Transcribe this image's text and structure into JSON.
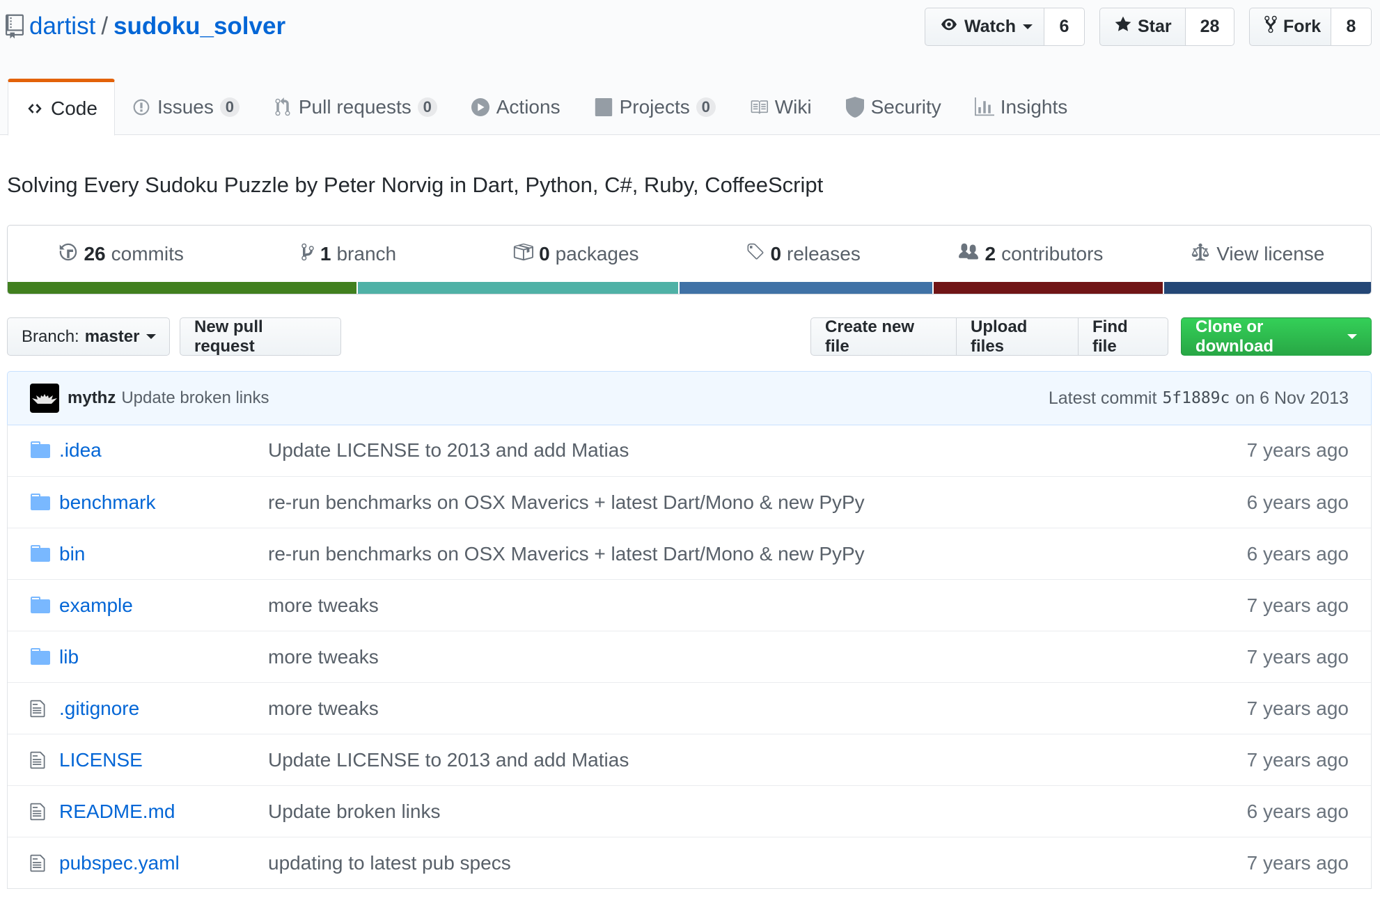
{
  "repo": {
    "owner": "dartist",
    "separator": "/",
    "name": "sudoku_solver",
    "description": "Solving Every Sudoku Puzzle by Peter Norvig in Dart, Python, C#, Ruby, CoffeeScript"
  },
  "actions": {
    "watch_label": "Watch",
    "watch_count": "6",
    "star_label": "Star",
    "star_count": "28",
    "fork_label": "Fork",
    "fork_count": "8"
  },
  "tabs": [
    {
      "label": "Code",
      "icon": "code-icon"
    },
    {
      "label": "Issues",
      "counter": "0",
      "icon": "issue-icon"
    },
    {
      "label": "Pull requests",
      "counter": "0",
      "icon": "pull-request-icon"
    },
    {
      "label": "Actions",
      "icon": "play-icon"
    },
    {
      "label": "Projects",
      "counter": "0",
      "icon": "project-icon"
    },
    {
      "label": "Wiki",
      "icon": "book-icon"
    },
    {
      "label": "Security",
      "icon": "shield-icon"
    },
    {
      "label": "Insights",
      "icon": "graph-icon"
    }
  ],
  "summary": [
    {
      "count": "26",
      "label": "commits",
      "icon": "history-icon"
    },
    {
      "count": "1",
      "label": "branch",
      "icon": "git-branch-icon"
    },
    {
      "count": "0",
      "label": "packages",
      "icon": "package-icon"
    },
    {
      "count": "0",
      "label": "releases",
      "icon": "tag-icon"
    },
    {
      "count": "2",
      "label": "contributors",
      "icon": "people-icon"
    },
    {
      "count": "",
      "label": "View license",
      "icon": "law-icon"
    }
  ],
  "language_colors": [
    "#41801f",
    "#4fb1a6",
    "#4072a6",
    "#701516",
    "#244776"
  ],
  "file_nav": {
    "branch_prefix": "Branch:",
    "branch_name": "master",
    "new_pr": "New pull request",
    "create_file": "Create new file",
    "upload_files": "Upload files",
    "find_file": "Find file",
    "clone": "Clone or download"
  },
  "latest_commit": {
    "author": "mythz",
    "message": "Update broken links",
    "prefix": "Latest commit",
    "sha": "5f1889c",
    "date": "on 6 Nov 2013"
  },
  "files": [
    {
      "type": "dir",
      "name": ".idea",
      "message": "Update LICENSE to 2013 and add Matias",
      "age": "7 years ago"
    },
    {
      "type": "dir",
      "name": "benchmark",
      "message": "re-run benchmarks on OSX Maverics + latest Dart/Mono & new PyPy",
      "age": "6 years ago"
    },
    {
      "type": "dir",
      "name": "bin",
      "message": "re-run benchmarks on OSX Maverics + latest Dart/Mono & new PyPy",
      "age": "6 years ago"
    },
    {
      "type": "dir",
      "name": "example",
      "message": "more tweaks",
      "age": "7 years ago"
    },
    {
      "type": "dir",
      "name": "lib",
      "message": "more tweaks",
      "age": "7 years ago"
    },
    {
      "type": "file",
      "name": ".gitignore",
      "message": "more tweaks",
      "age": "7 years ago"
    },
    {
      "type": "file",
      "name": "LICENSE",
      "message": "Update LICENSE to 2013 and add Matias",
      "age": "7 years ago"
    },
    {
      "type": "file",
      "name": "README.md",
      "message": "Update broken links",
      "age": "6 years ago"
    },
    {
      "type": "file",
      "name": "pubspec.yaml",
      "message": "updating to latest pub specs",
      "age": "7 years ago"
    }
  ]
}
